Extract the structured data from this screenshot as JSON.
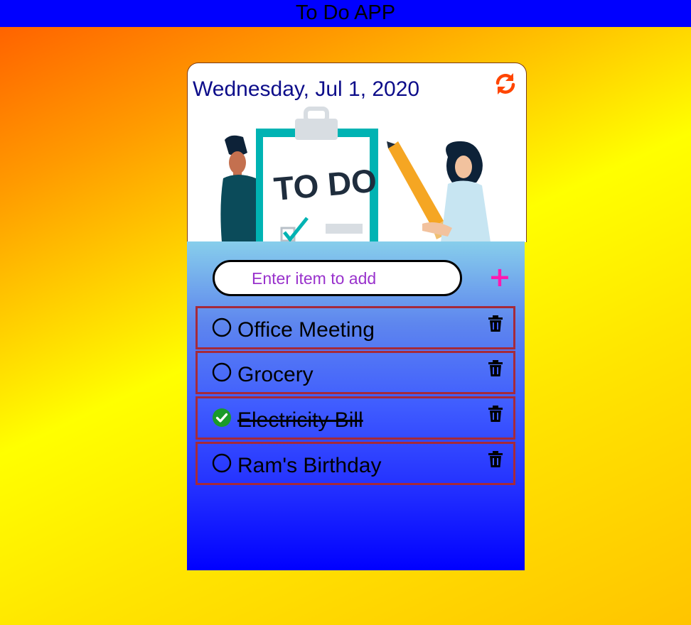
{
  "header": {
    "title": "To Do APP"
  },
  "card": {
    "date": "Wednesday, Jul 1, 2020",
    "illustration_text": "TO DO"
  },
  "input": {
    "placeholder": "Enter item to add",
    "value": ""
  },
  "add_button": {
    "label": "+"
  },
  "items": [
    {
      "label": "Office Meeting",
      "done": false
    },
    {
      "label": "Grocery",
      "done": false
    },
    {
      "label": "Electricity Bill",
      "done": true
    },
    {
      "label": "Ram's Birthday",
      "done": false
    }
  ],
  "colors": {
    "header": "#0000ff",
    "date_text": "#0d0d8a",
    "refresh_icon": "#ff4500",
    "add_button": "#ff1ab0",
    "item_border": "#a52a3a",
    "done_check": "#1a9a2a",
    "placeholder": "#9932cc"
  },
  "icons": {
    "refresh": "refresh-icon",
    "add": "plus-icon",
    "delete": "trash-icon",
    "unchecked": "circle-icon",
    "checked": "check-circle-icon"
  }
}
